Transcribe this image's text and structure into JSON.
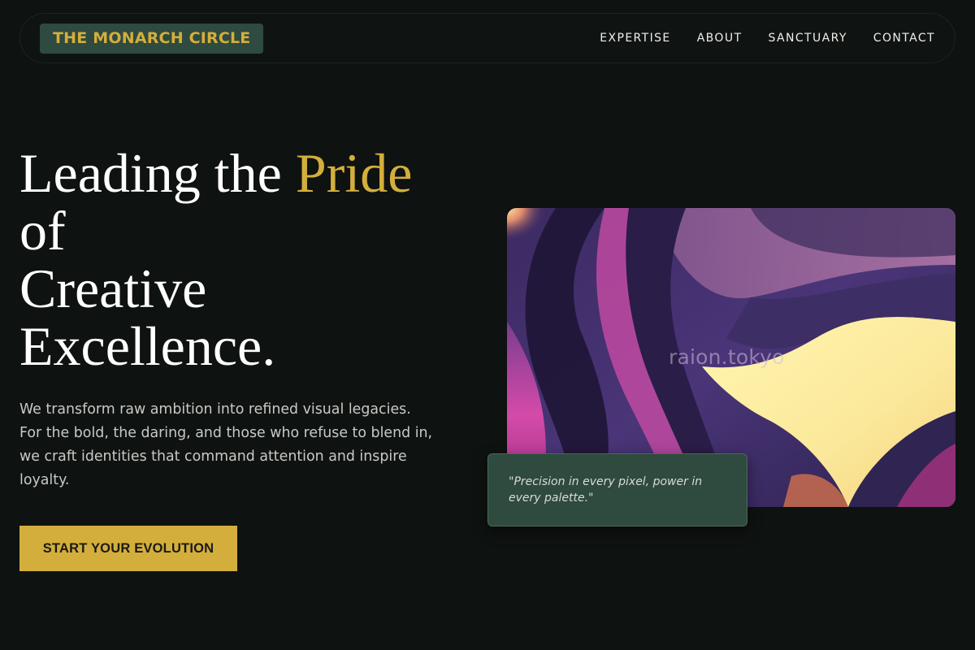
{
  "brand": {
    "name": "THE MONARCH CIRCLE",
    "accent_color": "#d4ae3c",
    "badge_color": "#2f4a3f"
  },
  "nav": {
    "items": [
      {
        "label": "EXPERTISE"
      },
      {
        "label": "ABOUT"
      },
      {
        "label": "SANCTUARY"
      },
      {
        "label": "CONTACT"
      }
    ]
  },
  "hero": {
    "title_part1": "Leading the ",
    "title_accent": "Pride",
    "title_line2": "of",
    "title_line3": "Creative",
    "title_line4": "Excellence.",
    "description": "We transform raw ambition into refined visual legacies. For the bold, the daring, and those who refuse to blend in, we craft identities that command attention and inspire loyalty.",
    "cta_label": "START YOUR EVOLUTION"
  },
  "showcase": {
    "watermark": "raion.tokyo",
    "quote": "\"Precision in every pixel, power in every palette.\"",
    "image_name": "abstract-purple-gold-artwork"
  },
  "colors": {
    "background": "#0e1210",
    "text": "#ffffff",
    "muted_text": "#c9c9c4"
  }
}
